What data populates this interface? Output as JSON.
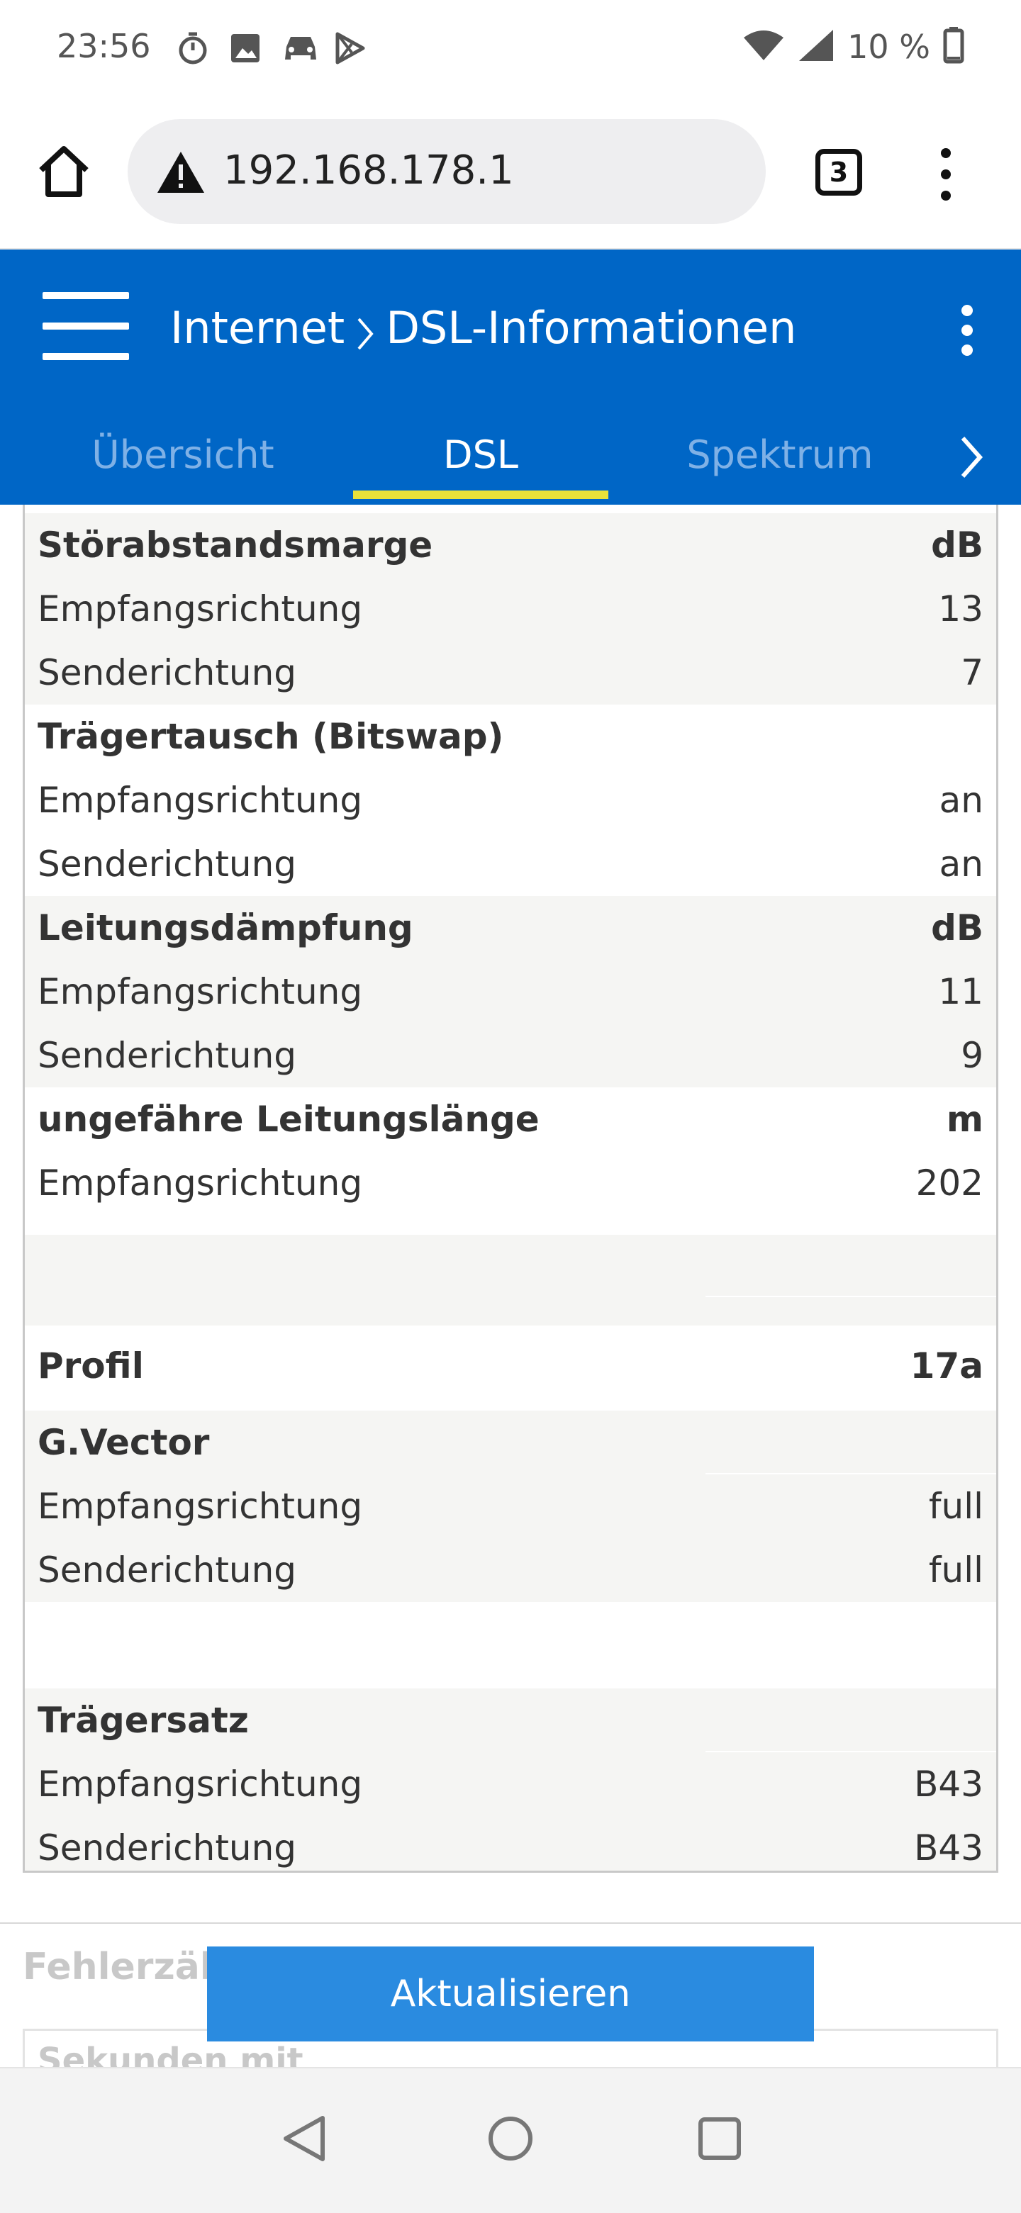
{
  "status_bar": {
    "time": "23:56",
    "battery": "10 %",
    "icons": [
      "timer-icon",
      "image-icon",
      "car-icon",
      "play-store-icon",
      "wifi-icon",
      "signal-icon",
      "battery-icon"
    ]
  },
  "browser": {
    "url": "192.168.178.1",
    "tab_count": "3",
    "icons": [
      "home-icon",
      "warning-icon",
      "more-vert-icon"
    ]
  },
  "header": {
    "breadcrumb_parent": "Internet",
    "breadcrumb_current": "DSL-Informationen",
    "tabs": [
      {
        "label": "Übersicht",
        "active": false
      },
      {
        "label": "DSL",
        "active": true
      },
      {
        "label": "Spektrum",
        "active": false
      }
    ],
    "colors": {
      "bar": "#0066c6",
      "underline": "#e8e23a"
    }
  },
  "table": {
    "rows": [
      {
        "label": "Störabstandsmarge",
        "value": "dB",
        "header": true
      },
      {
        "label": "Empfangsrichtung",
        "value": "13"
      },
      {
        "label": "Senderichtung",
        "value": "7"
      },
      {
        "label": "Trägertausch (Bitswap)",
        "value": "",
        "header": true
      },
      {
        "label": "Empfangsrichtung",
        "value": "an"
      },
      {
        "label": "Senderichtung",
        "value": "an"
      },
      {
        "label": "Leitungsdämpfung",
        "value": "dB",
        "header": true
      },
      {
        "label": "Empfangsrichtung",
        "value": "11"
      },
      {
        "label": "Senderichtung",
        "value": "9"
      },
      {
        "label": "ungefähre Leitungslänge",
        "value": "m",
        "header": true
      },
      {
        "label": "Empfangsrichtung",
        "value": "202"
      },
      {
        "label": "Profil",
        "value": "17a",
        "header": true
      },
      {
        "label": "G.Vector",
        "value": "",
        "header": true
      },
      {
        "label": "Empfangsrichtung",
        "value": "full"
      },
      {
        "label": "Senderichtung",
        "value": "full"
      },
      {
        "label": "Trägersatz",
        "value": "",
        "header": true
      },
      {
        "label": "Empfangsrichtung",
        "value": "B43"
      },
      {
        "label": "Senderichtung",
        "value": "B43"
      }
    ]
  },
  "lower": {
    "section_title": "Fehlerzähl",
    "first_row": "Sekunden mit"
  },
  "refresh_label": "Aktualisieren",
  "navbar": {
    "icons": [
      "back-icon",
      "home-circle-icon",
      "recents-icon"
    ]
  }
}
